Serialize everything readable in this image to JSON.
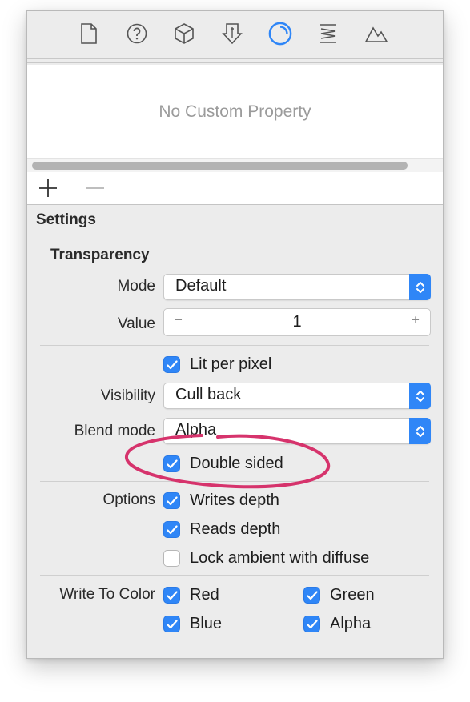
{
  "toolbar": {
    "icons": [
      "file-icon",
      "help-icon",
      "cube-icon",
      "attributes-icon",
      "material-icon",
      "physics-icon",
      "scene-icon"
    ],
    "accent": "#2f86f7"
  },
  "custom_properties": {
    "empty_text": "No Custom Property",
    "add_label": "+",
    "remove_label": "−"
  },
  "settings": {
    "title": "Settings",
    "transparency": {
      "title": "Transparency",
      "mode_label": "Mode",
      "mode_value": "Default",
      "value_label": "Value",
      "value": "1",
      "decrement": "−",
      "increment": "+"
    },
    "lit_per_pixel": {
      "label": "Lit per pixel",
      "checked": true
    },
    "visibility": {
      "label": "Visibility",
      "value": "Cull back"
    },
    "blend_mode": {
      "label": "Blend mode",
      "value": "Alpha"
    },
    "double_sided": {
      "label": "Double sided",
      "checked": true
    },
    "options": {
      "label": "Options",
      "writes_depth": {
        "label": "Writes depth",
        "checked": true
      },
      "reads_depth": {
        "label": "Reads depth",
        "checked": true
      },
      "lock_ambient": {
        "label": "Lock ambient with diffuse",
        "checked": false
      }
    },
    "write_to_color": {
      "label": "Write To Color",
      "red": {
        "label": "Red",
        "checked": true
      },
      "green": {
        "label": "Green",
        "checked": true
      },
      "blue": {
        "label": "Blue",
        "checked": true
      },
      "alpha": {
        "label": "Alpha",
        "checked": true
      }
    }
  },
  "annotation_color": "#d6336c"
}
